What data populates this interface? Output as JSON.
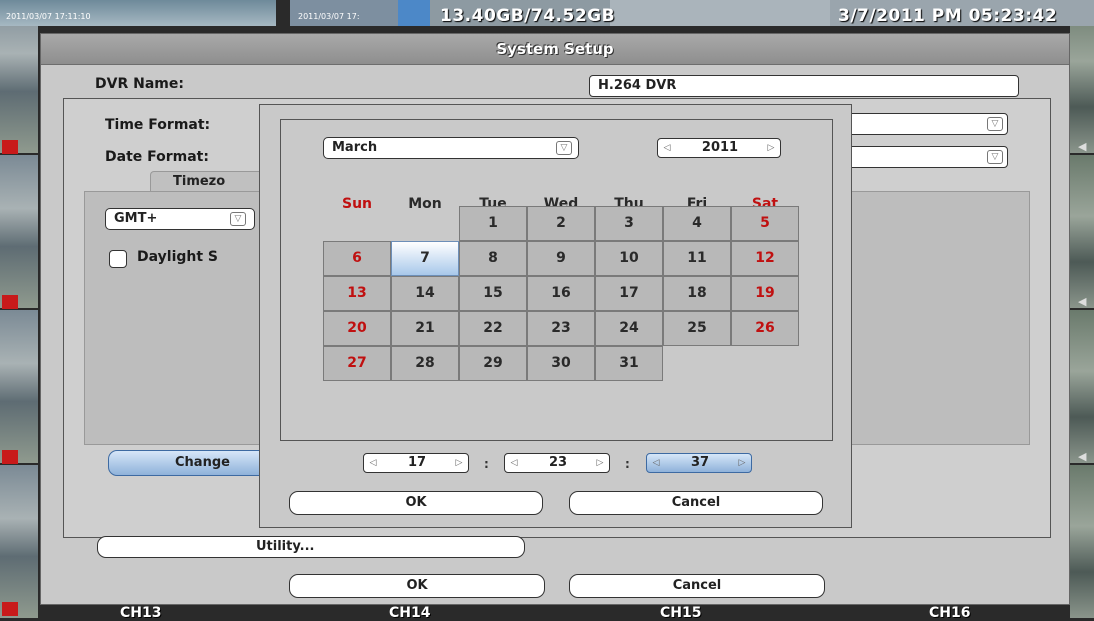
{
  "status": {
    "left_timestamp": "2011/03/07  17:11:10",
    "mid_timestamp": "2011/03/07  17:",
    "disk_usage": "13.40GB/74.52GB",
    "datetime": "3/7/2011 PM 05:23:42"
  },
  "window": {
    "title": "System Setup",
    "dvr_name_label": "DVR Name:",
    "dvr_name_value": "H.264 DVR",
    "time_format_label": "Time Format:",
    "date_format_label": "Date Format:",
    "timezone_tab": "Timezo",
    "gmt_value": "GMT+",
    "daylight_label": "Daylight S",
    "change_button": "Change",
    "utility_button": "Utility...",
    "ok_button": "OK",
    "cancel_button": "Cancel"
  },
  "datepicker": {
    "month": "March",
    "year": "2011",
    "weekdays": [
      "Sun",
      "Mon",
      "Tue",
      "Wed",
      "Thu",
      "Fri",
      "Sat"
    ],
    "selected_day": "7",
    "weeks": [
      [
        "",
        "",
        "1",
        "2",
        "3",
        "4",
        "5"
      ],
      [
        "6",
        "7",
        "8",
        "9",
        "10",
        "11",
        "12"
      ],
      [
        "13",
        "14",
        "15",
        "16",
        "17",
        "18",
        "19"
      ],
      [
        "20",
        "21",
        "22",
        "23",
        "24",
        "25",
        "26"
      ],
      [
        "27",
        "28",
        "29",
        "30",
        "31",
        "",
        ""
      ]
    ],
    "hour": "17",
    "minute": "23",
    "second": "37",
    "separator": ":",
    "ok_button": "OK",
    "cancel_button": "Cancel"
  },
  "channels": [
    "CH13",
    "CH14",
    "CH15",
    "CH16"
  ],
  "icons": {
    "dropdown": "chevron-down-icon",
    "spin_left": "triangle-left-icon",
    "spin_right": "triangle-right-icon",
    "record": "film-icon",
    "speaker": "speaker-icon"
  },
  "colors": {
    "weekend": "#c01010",
    "selected_blue": "#8fb2da",
    "window_gray": "#c9c9c9"
  }
}
